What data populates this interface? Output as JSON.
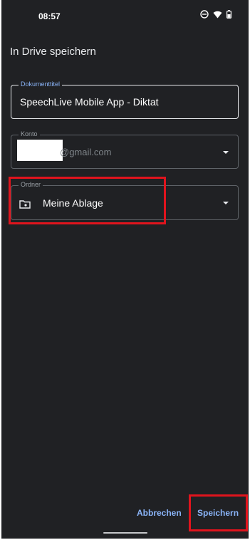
{
  "status_bar": {
    "time": "08:57",
    "icons": [
      "do-not-disturb-icon",
      "wifi-icon",
      "battery-icon"
    ]
  },
  "dialog": {
    "title": "In Drive speichern",
    "document_title_field": {
      "label": "Dokumenttitel",
      "value": "SpeechLive Mobile App - Diktat"
    },
    "account_field": {
      "label": "Konto",
      "value_visible": "@gmail.com"
    },
    "folder_field": {
      "label": "Ordner",
      "value": "Meine Ablage",
      "icon": "folder-icon"
    },
    "actions": {
      "cancel_label": "Abbrechen",
      "save_label": "Speichern"
    }
  },
  "colors": {
    "background": "#202124",
    "accent": "#8ab4f8",
    "highlight": "#e0141d"
  }
}
